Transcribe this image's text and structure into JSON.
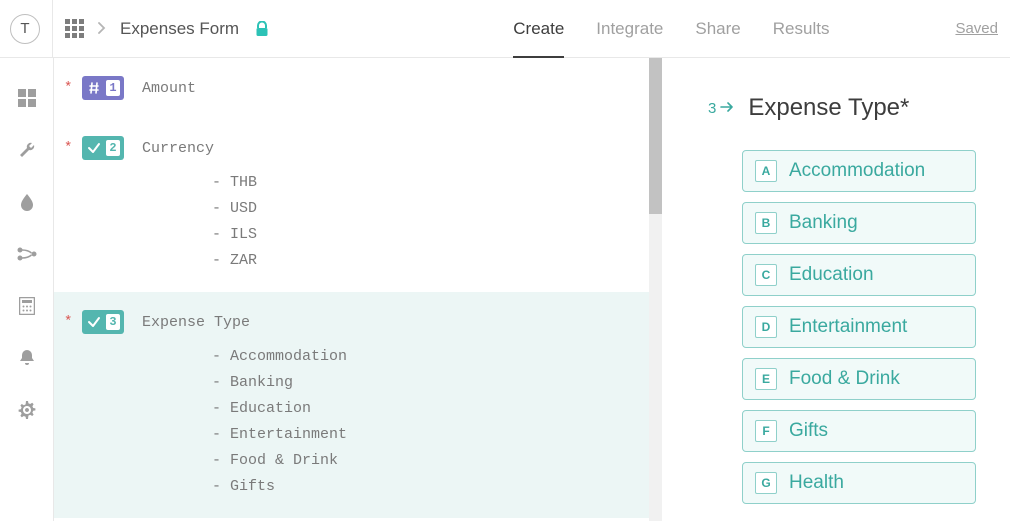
{
  "header": {
    "avatar_letter": "T",
    "form_title": "Expenses Form",
    "tabs": {
      "create": "Create",
      "integrate": "Integrate",
      "share": "Share",
      "results": "Results"
    },
    "saved": "Saved"
  },
  "questions": [
    {
      "required": "*",
      "badge_type": "number",
      "num": "1",
      "title": "Amount",
      "options": []
    },
    {
      "required": "*",
      "badge_type": "choice",
      "num": "2",
      "title": "Currency",
      "options": [
        "THB",
        "USD",
        "ILS",
        "ZAR"
      ]
    },
    {
      "required": "*",
      "badge_type": "choice",
      "num": "3",
      "title": "Expense Type",
      "options": [
        "Accommodation",
        "Banking",
        "Education",
        "Entertainment",
        "Food & Drink",
        "Gifts"
      ]
    }
  ],
  "preview": {
    "number": "3",
    "title": "Expense Type*",
    "options": [
      {
        "key": "A",
        "label": "Accommodation"
      },
      {
        "key": "B",
        "label": "Banking"
      },
      {
        "key": "C",
        "label": "Education"
      },
      {
        "key": "D",
        "label": "Entertainment"
      },
      {
        "key": "E",
        "label": "Food & Drink"
      },
      {
        "key": "F",
        "label": "Gifts"
      },
      {
        "key": "G",
        "label": "Health"
      }
    ]
  }
}
